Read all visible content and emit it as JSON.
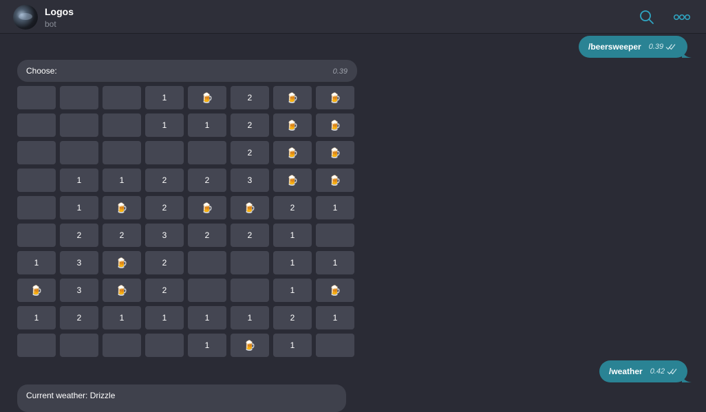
{
  "header": {
    "title": "Logos",
    "subtitle": "bot",
    "accent_color": "#2fa7c4",
    "icons": [
      "search-icon",
      "more-icon"
    ]
  },
  "messages": {
    "cmd1": {
      "text": "/beersweeper",
      "time": "0.39"
    },
    "choose": {
      "text": "Choose:",
      "time": "0.39"
    },
    "cmd2": {
      "text": "/weather",
      "time": "0.42"
    },
    "weather": {
      "text": "Current weather: Drizzle"
    }
  },
  "board": {
    "beer_icon": "🍺",
    "rows": [
      [
        "",
        "",
        "",
        "1",
        "🍺",
        "2",
        "🍺",
        "🍺"
      ],
      [
        "",
        "",
        "",
        "1",
        "1",
        "2",
        "🍺",
        "🍺"
      ],
      [
        "",
        "",
        "",
        "",
        "",
        "2",
        "🍺",
        "🍺"
      ],
      [
        "",
        "1",
        "1",
        "2",
        "2",
        "3",
        "🍺",
        "🍺"
      ],
      [
        "",
        "1",
        "🍺",
        "2",
        "🍺",
        "🍺",
        "2",
        "1"
      ],
      [
        "",
        "2",
        "2",
        "3",
        "2",
        "2",
        "1",
        ""
      ],
      [
        "1",
        "3",
        "🍺",
        "2",
        "",
        "",
        "1",
        "1"
      ],
      [
        "🍺",
        "3",
        "🍺",
        "2",
        "",
        "",
        "1",
        "🍺"
      ],
      [
        "1",
        "2",
        "1",
        "1",
        "1",
        "1",
        "2",
        "1"
      ],
      [
        "",
        "",
        "",
        "",
        "1",
        "🍺",
        "1",
        ""
      ]
    ]
  },
  "colors": {
    "background": "#2a2b35",
    "outgoing_bubble": "#2a8394",
    "incoming_bubble": "#3f414c",
    "cell": "#444652"
  }
}
